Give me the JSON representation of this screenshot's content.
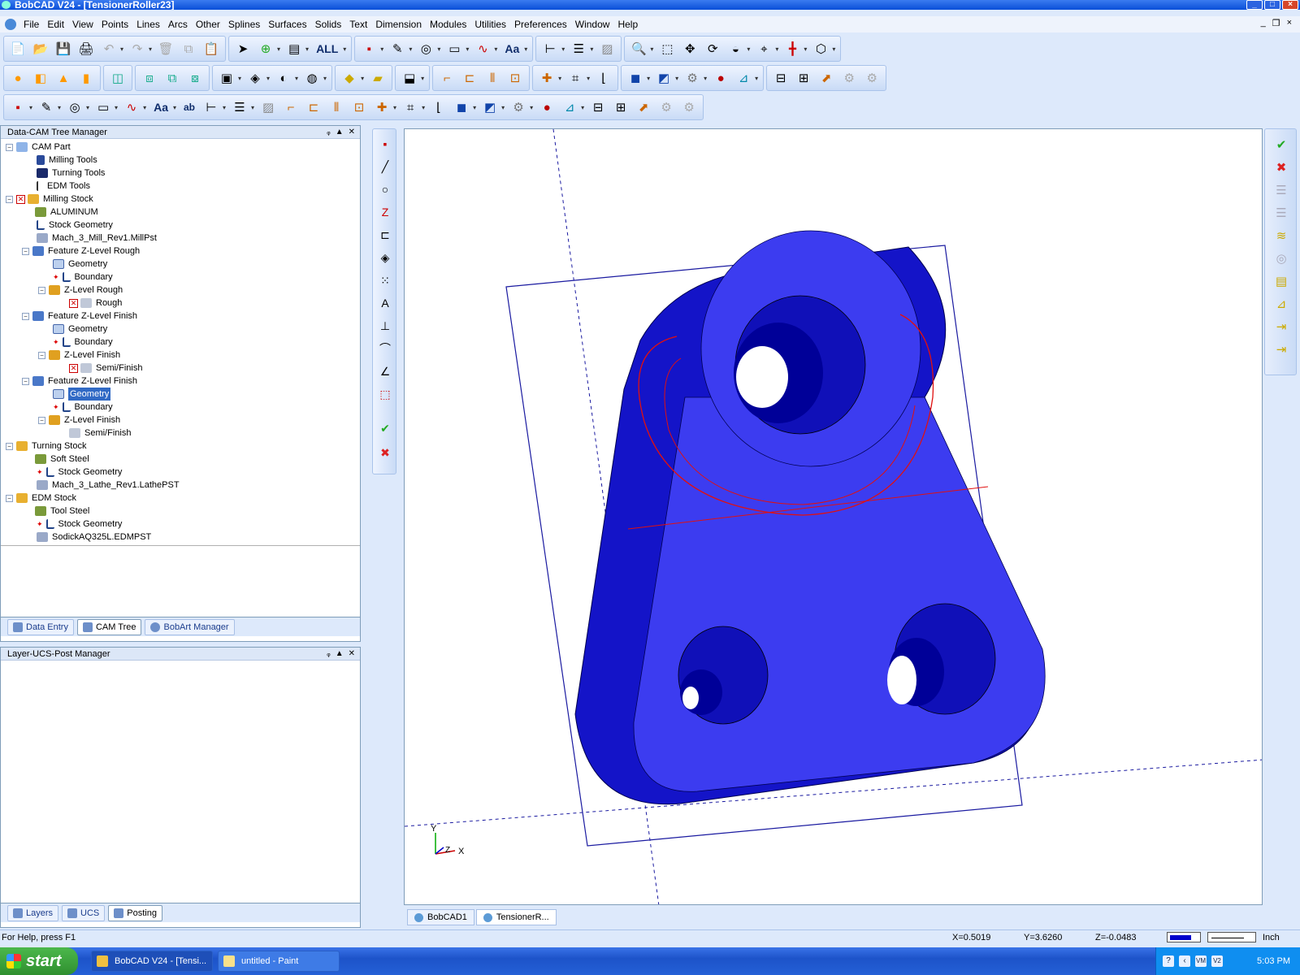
{
  "window": {
    "title": "BobCAD V24 - [TensionerRoller23]",
    "controls": [
      "_",
      "□",
      "×"
    ]
  },
  "menu": {
    "items": [
      "File",
      "Edit",
      "View",
      "Points",
      "Lines",
      "Arcs",
      "Other",
      "Splines",
      "Surfaces",
      "Solids",
      "Text",
      "Dimension",
      "Modules",
      "Utilities",
      "Preferences",
      "Window",
      "Help"
    ],
    "mdi_controls": [
      "_",
      "❐",
      "×"
    ]
  },
  "toolbar": {
    "all_label": "ALL",
    "text_label": "Aa",
    "text_label_2": "Aa",
    "text_label_3": "ab"
  },
  "tree_panel": {
    "title": "Data-CAM Tree Manager",
    "header_controls": [
      "ᵩ",
      "▲",
      "✕"
    ],
    "nodes": [
      {
        "label": "CAM Part"
      },
      {
        "label": "Milling Tools"
      },
      {
        "label": "Turning Tools"
      },
      {
        "label": "EDM Tools"
      },
      {
        "label": "Milling Stock"
      },
      {
        "label": "ALUMINUM"
      },
      {
        "label": "Stock Geometry"
      },
      {
        "label": "Mach_3_Mill_Rev1.MillPst"
      },
      {
        "label": "Feature Z-Level Rough"
      },
      {
        "label": "Geometry"
      },
      {
        "label": "Boundary"
      },
      {
        "label": "Z-Level Rough"
      },
      {
        "label": "Rough"
      },
      {
        "label": "Feature Z-Level Finish"
      },
      {
        "label": "Geometry"
      },
      {
        "label": "Boundary"
      },
      {
        "label": "Z-Level Finish"
      },
      {
        "label": "Semi/Finish"
      },
      {
        "label": "Feature Z-Level Finish"
      },
      {
        "label": "Geometry"
      },
      {
        "label": "Boundary"
      },
      {
        "label": "Z-Level Finish"
      },
      {
        "label": "Semi/Finish"
      },
      {
        "label": "Turning Stock"
      },
      {
        "label": "Soft Steel"
      },
      {
        "label": "Stock Geometry"
      },
      {
        "label": "Mach_3_Lathe_Rev1.LathePST"
      },
      {
        "label": "EDM Stock"
      },
      {
        "label": "Tool Steel"
      },
      {
        "label": "Stock Geometry"
      },
      {
        "label": "SodickAQ325L.EDMPST"
      }
    ],
    "tabs": [
      "Data Entry",
      "CAM Tree",
      "BobArt Manager"
    ]
  },
  "layer_panel": {
    "title": "Layer-UCS-Post Manager",
    "header_controls": [
      "ᵩ",
      "▲",
      "✕"
    ],
    "tabs": [
      "Layers",
      "UCS",
      "Posting"
    ]
  },
  "viewport": {
    "axis_y": "Y",
    "axis_x": "X",
    "axis_z": "Z",
    "model_color": "#3c3cf0",
    "toolpath_color": "#e01010",
    "boundary_color": "#1a1aa0"
  },
  "doc_tabs": [
    "BobCAD1",
    "TensionerR..."
  ],
  "status": {
    "help": "For Help, press F1",
    "x": "X=0.5019",
    "y": "Y=3.6260",
    "z": "Z=-0.0483",
    "units": "Inch"
  },
  "taskbar": {
    "start": "start",
    "items": [
      "BobCAD V24 - [Tensi...",
      "untitled - Paint"
    ],
    "clock": "5:03 PM",
    "tray_icons": [
      "?",
      "‹",
      "VM",
      "V2"
    ]
  }
}
